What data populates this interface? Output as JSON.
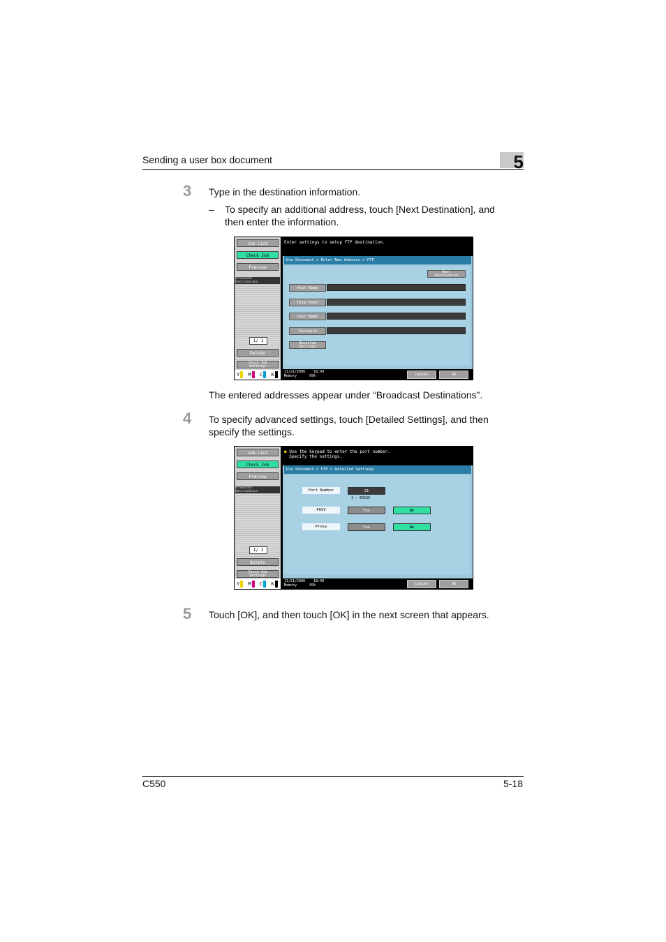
{
  "header": {
    "section_title": "Sending a user box document",
    "chapter": "5"
  },
  "steps": [
    {
      "number": "3",
      "text": "Type in the destination information.",
      "bullet": {
        "dash": "–",
        "line1": "To specify an additional address, touch [Next Destination], and",
        "line2": "then enter the information."
      }
    },
    {
      "number": "4",
      "line1": "To specify advanced settings, touch [Detailed Settings], and then",
      "line2": "specify the settings."
    },
    {
      "number": "5",
      "text": "Touch [OK], and then touch [OK] in the next screen that appears."
    }
  ],
  "result_text": "The entered addresses appear under “Broadcast Destinations”.",
  "screen1": {
    "side": {
      "job_list": "Job List",
      "check_job": "Check Job",
      "preview": "Preview",
      "broadcast_line1": "Broadcast",
      "broadcast_line2": "Destinations",
      "pager": "1/  1",
      "delete": "Delete",
      "check_job_settings_line1": "Check Job",
      "check_job_settings_line2": "Settings"
    },
    "toner": {
      "y": "Y",
      "m": "M",
      "c": "C",
      "k": "K"
    },
    "message": "Enter settings to setup FTP destination.",
    "breadcrumb": "Use Document > Enter New Address > FTP",
    "next_destination_line1": "Next",
    "next_destination_line2": "Destination",
    "fields": [
      "Host Name",
      "File Path",
      "User Name",
      "Password"
    ],
    "detailed_line1": "Detailed",
    "detailed_line2": "Settings",
    "status_date": "11/21/2006",
    "status_time": "18:09",
    "status_memory_label": "Memory",
    "status_memory": "99%",
    "cancel": "Cancel",
    "ok": "OK"
  },
  "screen2": {
    "side": {
      "job_list": "Job List",
      "check_job": "Check Job",
      "preview": "Preview",
      "broadcast_line1": "Broadcast",
      "broadcast_line2": "Destinations",
      "pager": "1/  1",
      "delete": "Delete",
      "check_job_settings_line1": "Check Job",
      "check_job_settings_line2": "Settings"
    },
    "toner": {
      "y": "Y",
      "m": "M",
      "c": "C",
      "k": "K"
    },
    "message_line1": "Use the keypad to enter the port number.",
    "message_line2": "Specify the settings.",
    "breadcrumb": "Use Document > FTP > Detailed Settings",
    "port_label": "Port Number",
    "port_value": "21",
    "port_range_min": "1",
    "port_range_sep": "–",
    "port_range_max": "65535",
    "pasv_label": "PASV",
    "proxy_label": "Proxy",
    "yes": "Yes",
    "no": "No",
    "status_date": "11/21/2006",
    "status_time": "18:09",
    "status_memory_label": "Memory",
    "status_memory": "99%",
    "cancel": "Cancel",
    "ok": "OK"
  },
  "footer": {
    "model": "C550",
    "page": "5-18"
  },
  "colors": {
    "highlight_green": "#2fe0a0",
    "screen_blue": "#9ec9dc",
    "breadcrumb_blue": "#2a7da6"
  }
}
